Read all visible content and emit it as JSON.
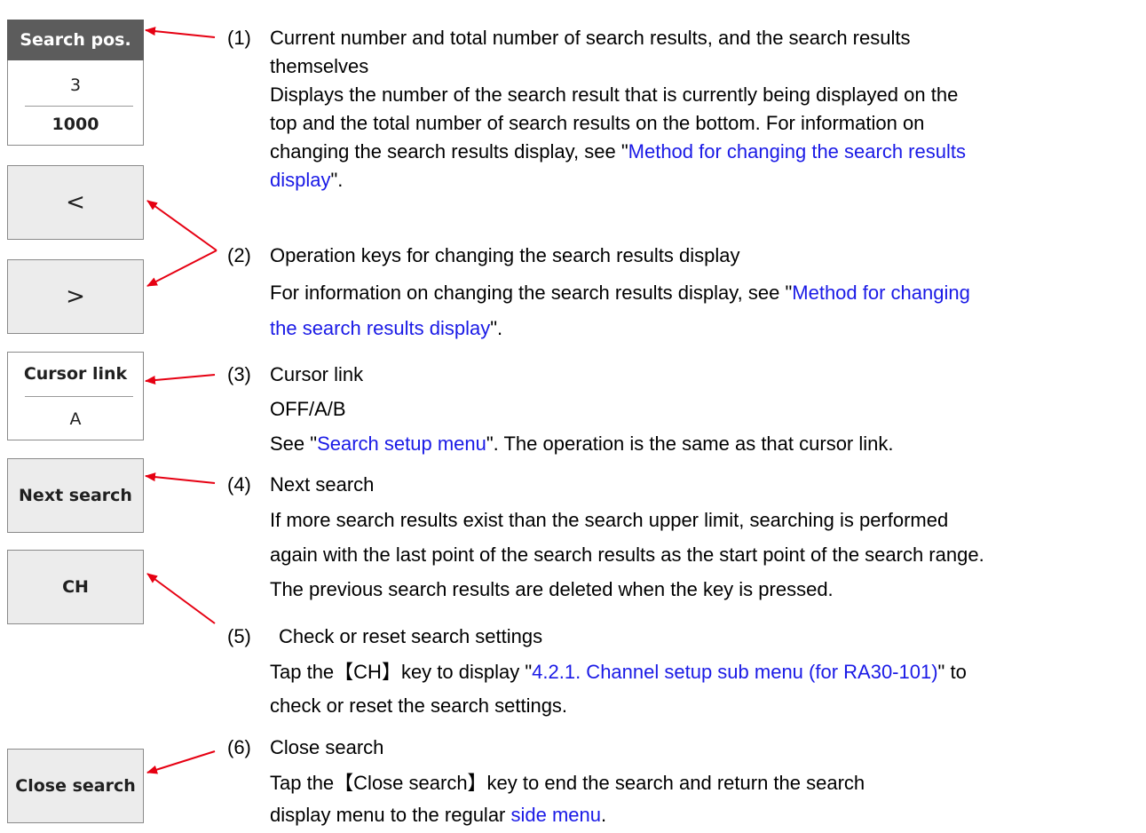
{
  "widgets": {
    "search_pos": {
      "header": "Search pos.",
      "current": "3",
      "total": "1000"
    },
    "prev_label": "<",
    "next_label": ">",
    "cursor_link": {
      "header": "Cursor link",
      "value": "A"
    },
    "next_search_label": "Next search",
    "ch_label": "CH",
    "close_search_label": "Close search"
  },
  "items": [
    {
      "num": "(1)",
      "title_1": "Current number and total number of search results, and the search results",
      "title_2": "themselves",
      "d1": "Displays the number of the search result that is currently being displayed on the",
      "d2": "top and the total number of search results on the bottom. For information on",
      "d3_pre": "changing the search results display, see \"",
      "d3_link": "Method for changing the search results",
      "d4_link": "display",
      "d4_post": "\"."
    },
    {
      "num": "(2)",
      "title": "Operation keys for changing the search results display",
      "d1_pre": "For information on changing the search results display, see \"",
      "d1_link": "Method for changing",
      "d2_link": "the search results display",
      "d2_post": "\"."
    },
    {
      "num": "(3)",
      "title": "Cursor link",
      "d1": "OFF/A/B",
      "d2_pre": "See \"",
      "d2_link": "Search setup menu",
      "d2_post": "\". The operation is the same as that cursor link."
    },
    {
      "num": "(4)",
      "title": "Next search",
      "d1": "If more search results exist than the search upper limit, searching is performed",
      "d2": "again with the last point of the search results as the start point of the search range.",
      "d3": "The previous search results are deleted when the key is pressed."
    },
    {
      "num": "(5)",
      "title": "Check or reset search settings",
      "d1_pre": "Tap the【CH】key to display \"",
      "d1_link": "4.2.1. Channel setup sub menu (for RA30-101)",
      "d1_post": "\" to",
      "d2": "check or reset the search settings."
    },
    {
      "num": "(6)",
      "title": "Close search",
      "d1": "Tap the【Close search】key to end the search and return the search",
      "d2_pre": "display menu to the regular ",
      "d2_link": "side menu",
      "d2_post": "."
    }
  ],
  "colors": {
    "arrow": "#e60012",
    "link": "#1a1ae6",
    "header_bg": "#5c5c5c",
    "button_bg": "#ececec"
  }
}
